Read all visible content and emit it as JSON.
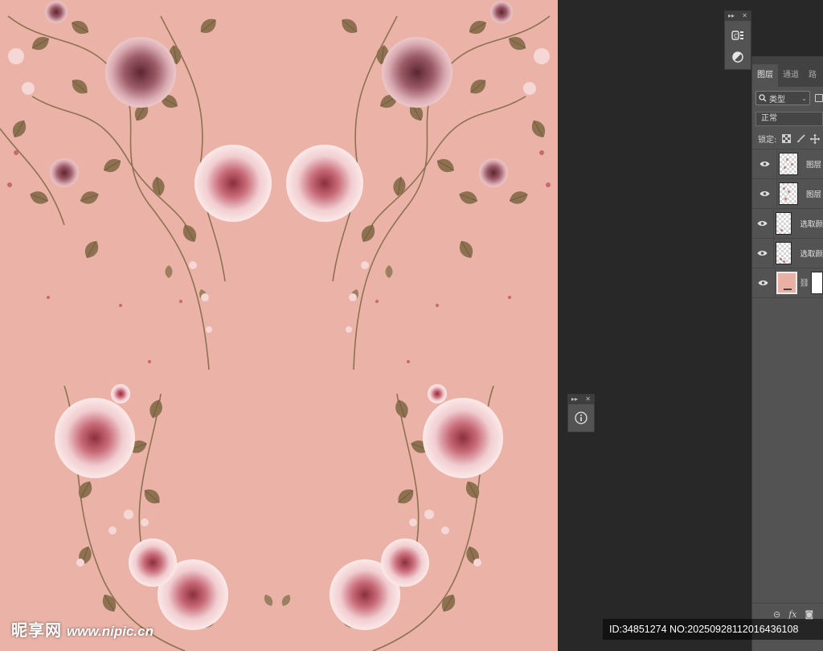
{
  "canvas": {
    "background": "#ebb3a8",
    "artwork": "pink-rose-floral-pattern"
  },
  "watermark": {
    "logo": "昵享网",
    "url": "www.nipic.cn",
    "id_text": "ID:34851274 NO:20250928112016436108"
  },
  "mini_dock_top": {
    "icons": [
      "libraries-icon",
      "adjustments-icon"
    ]
  },
  "mini_dock_info": {
    "icons": [
      "info-icon"
    ]
  },
  "layers_panel": {
    "tabs": [
      {
        "label": "图层",
        "active": true
      },
      {
        "label": "通道",
        "active": false
      },
      {
        "label": "路",
        "active": false
      }
    ],
    "filter_kind": "类型",
    "blend_mode": "正常",
    "lock_label": "锁定:",
    "layers": [
      {
        "name": "图层",
        "visible": true
      },
      {
        "name": "图层",
        "visible": true
      },
      {
        "name": "选取颜",
        "visible": true
      },
      {
        "name": "选取颜",
        "visible": true
      },
      {
        "name": "",
        "visible": true,
        "type": "solid-color-fill",
        "fill_color": "#e9b1a5"
      }
    ],
    "bottom_icons": [
      "link-icon",
      "fx-icon",
      "mask-icon"
    ],
    "fx_label": "fx"
  }
}
